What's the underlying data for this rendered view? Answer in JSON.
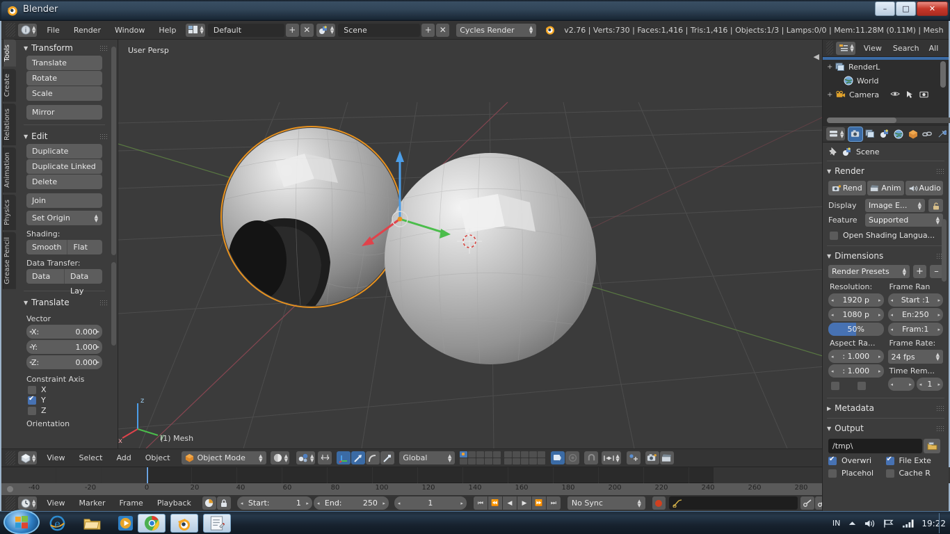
{
  "window": {
    "title": "Blender",
    "buttons": {
      "minimize": "–",
      "maximize": "□",
      "close": "✕"
    }
  },
  "topbar": {
    "editor_icon": "info-editor-icon",
    "menus": [
      "File",
      "Render",
      "Window",
      "Help"
    ],
    "screen_layout": "Default",
    "scene_name": "Scene",
    "engine": "Cycles Render",
    "add_label": "+",
    "remove_label": "✕",
    "stats": "v2.76 | Verts:730 | Faces:1,416 | Tris:1,416 | Objects:1/3 | Lamps:0/0 | Mem:11.28M (0.11M) | Mesh"
  },
  "toolshelf": {
    "tabs": [
      {
        "label": "Tools",
        "active": true
      },
      {
        "label": "Create",
        "active": false
      },
      {
        "label": "Relations",
        "active": false
      },
      {
        "label": "Animation",
        "active": false
      },
      {
        "label": "Physics",
        "active": false
      },
      {
        "label": "Grease Pencil",
        "active": false
      }
    ],
    "transform": {
      "title": "Transform",
      "buttons": [
        "Translate",
        "Rotate",
        "Scale"
      ],
      "mirror": "Mirror"
    },
    "edit": {
      "title": "Edit",
      "buttons": [
        "Duplicate",
        "Duplicate Linked",
        "Delete"
      ],
      "join": "Join",
      "set_origin": "Set Origin",
      "shading_label": "Shading:",
      "shading_smooth": "Smooth",
      "shading_flat": "Flat",
      "data_transfer_label": "Data Transfer:",
      "data": "Data",
      "data_layout": "Data Lay"
    },
    "translate_panel": {
      "title": "Translate",
      "vector_label": "Vector",
      "x_label": "X:",
      "x_value": "0.000",
      "y_label": "Y:",
      "y_value": "1.000",
      "z_label": "Z:",
      "z_value": "0.000",
      "constraint_label": "Constraint Axis",
      "axes": [
        {
          "label": "X",
          "checked": false
        },
        {
          "label": "Y",
          "checked": true
        },
        {
          "label": "Z",
          "checked": false
        }
      ],
      "orientation_label": "Orientation"
    }
  },
  "viewport": {
    "perspective_label": "User Persp",
    "mesh_name": "(1) Mesh",
    "gizmo_axes": {
      "x": "x",
      "y": "y",
      "z": "z"
    }
  },
  "viewport_header": {
    "editor_icon": "3d-view-editor-icon",
    "menus": [
      "View",
      "Select",
      "Add",
      "Object"
    ],
    "mode": "Object Mode",
    "shading": "solid-shading-icon",
    "pivot": "pivot-median-point-icon",
    "manipulator_translate": "translate-manipulator-icon",
    "manipulator_rotate": "rotate-manipulator-icon",
    "manipulator_scale": "scale-manipulator-icon",
    "orientation": "Global",
    "snap": "snap-magnet-icon",
    "proportional": "proportional-edit-icon",
    "layers_label": "scene-layers"
  },
  "timeline": {
    "ruler_ticks": [
      "-40",
      "-20",
      "0",
      "20",
      "40",
      "60",
      "80",
      "100",
      "120",
      "140",
      "160",
      "180",
      "200",
      "220",
      "240",
      "260",
      "280"
    ],
    "playhead_frame": "1",
    "editor_icon": "timeline-editor-icon",
    "menus": [
      "View",
      "Marker",
      "Frame",
      "Playback"
    ],
    "start_label": "Start:",
    "start_value": "1",
    "end_label": "End:",
    "end_value": "250",
    "current_frame": "1",
    "sync_mode": "No Sync",
    "record_label": "record-button",
    "keying_set_placeholder": ""
  },
  "outliner": {
    "header": {
      "editor_icon": "outliner-editor-icon",
      "view": "View",
      "search": "Search",
      "filter": "All Sc"
    },
    "rows": [
      {
        "label": "RenderL",
        "icon": "renderlayers-icon",
        "expand": "+",
        "selected": false
      },
      {
        "label": "World",
        "icon": "world-icon",
        "expand": "",
        "selected": false
      },
      {
        "label": "Camera",
        "icon": "camera-icon",
        "expand": "+",
        "selected": false
      }
    ]
  },
  "properties": {
    "tabs": [
      {
        "name": "render-tab",
        "icon": "camera-back-icon",
        "active": true
      },
      {
        "name": "render-layers-tab",
        "icon": "images-icon",
        "active": false
      },
      {
        "name": "scene-tab",
        "icon": "scene-icon",
        "active": false
      },
      {
        "name": "world-tab",
        "icon": "world-globe-icon",
        "active": false
      },
      {
        "name": "object-tab",
        "icon": "cube-icon",
        "active": false
      },
      {
        "name": "constraints-tab",
        "icon": "chain-link-icon",
        "active": false
      },
      {
        "name": "modifiers-tab",
        "icon": "wrench-icon",
        "active": false
      }
    ],
    "breadcrumb": "Scene",
    "render": {
      "title": "Render",
      "render_btn": "Rend",
      "animation_btn": "Anim",
      "audio_btn": "Audio",
      "display_label": "Display",
      "display_value": "Image E...",
      "feature_label": "Feature",
      "feature_value": "Supported",
      "osl_label": "Open Shading Langua...",
      "osl_checked": false
    },
    "dimensions": {
      "title": "Dimensions",
      "presets": "Render Presets",
      "preset_add": "+",
      "preset_remove": "–",
      "resolution_label": "Resolution:",
      "res_x": "1920 p",
      "res_y": "1080 p",
      "res_percent": "50%",
      "aspect_label": "Aspect Ra...",
      "aspect_x": ": 1.000",
      "aspect_y": ": 1.000",
      "frame_range_label": "Frame Ran",
      "frame_start": "Start :1",
      "frame_end": "En:250",
      "frame_step": "Fram:1",
      "frame_rate_label": "Frame Rate:",
      "frame_rate": "24 fps",
      "time_remap_label": "Time Rem...",
      "time_remap_value": "1"
    },
    "metadata": {
      "title": "Metadata"
    },
    "output": {
      "title": "Output",
      "path": "/tmp\\",
      "overwrite_label": "Overwri",
      "overwrite_checked": true,
      "file_ext_label": "File Exte",
      "file_ext_checked": true,
      "placeholder_label": "Placehol",
      "placeholder_checked": false,
      "cache_label": "Cache R",
      "cache_checked": false
    }
  },
  "taskbar": {
    "start": "windows-start-button",
    "apps": [
      {
        "name": "internet-explorer",
        "pinned": true
      },
      {
        "name": "file-explorer",
        "pinned": true
      },
      {
        "name": "media-player",
        "pinned": true
      },
      {
        "name": "google-chrome",
        "running": true
      },
      {
        "name": "blender",
        "running": true
      },
      {
        "name": "notepad",
        "running": true
      }
    ],
    "tray": {
      "language": "IN",
      "clock": "19:22"
    }
  }
}
